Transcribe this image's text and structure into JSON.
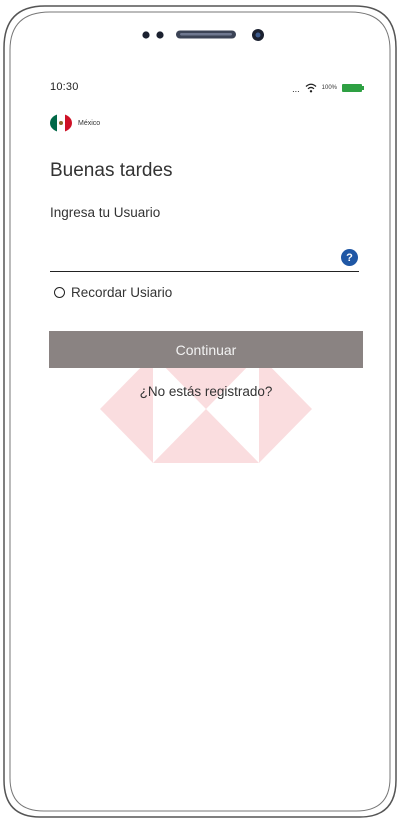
{
  "status_bar": {
    "time": "10:30",
    "signal": "...",
    "battery_percent": "100%",
    "wifi_icon": "wifi-icon",
    "battery_color": "#2ea043"
  },
  "country": {
    "name": "México",
    "flag_icon": "mexico-flag-icon"
  },
  "greeting": "Buenas tardes",
  "login": {
    "user_label": "Ingresa tu Usuario",
    "user_value": "",
    "help_glyph": "?",
    "help_icon": "help-icon",
    "remember_label": "Recordar Usiario",
    "remember_checked": false,
    "continue_label": "Continuar",
    "register_link": "¿No estás registrado?"
  },
  "colors": {
    "button_bg": "#8a8382",
    "help_icon": "#1f57a5",
    "brand_watermark": "#db0011"
  }
}
